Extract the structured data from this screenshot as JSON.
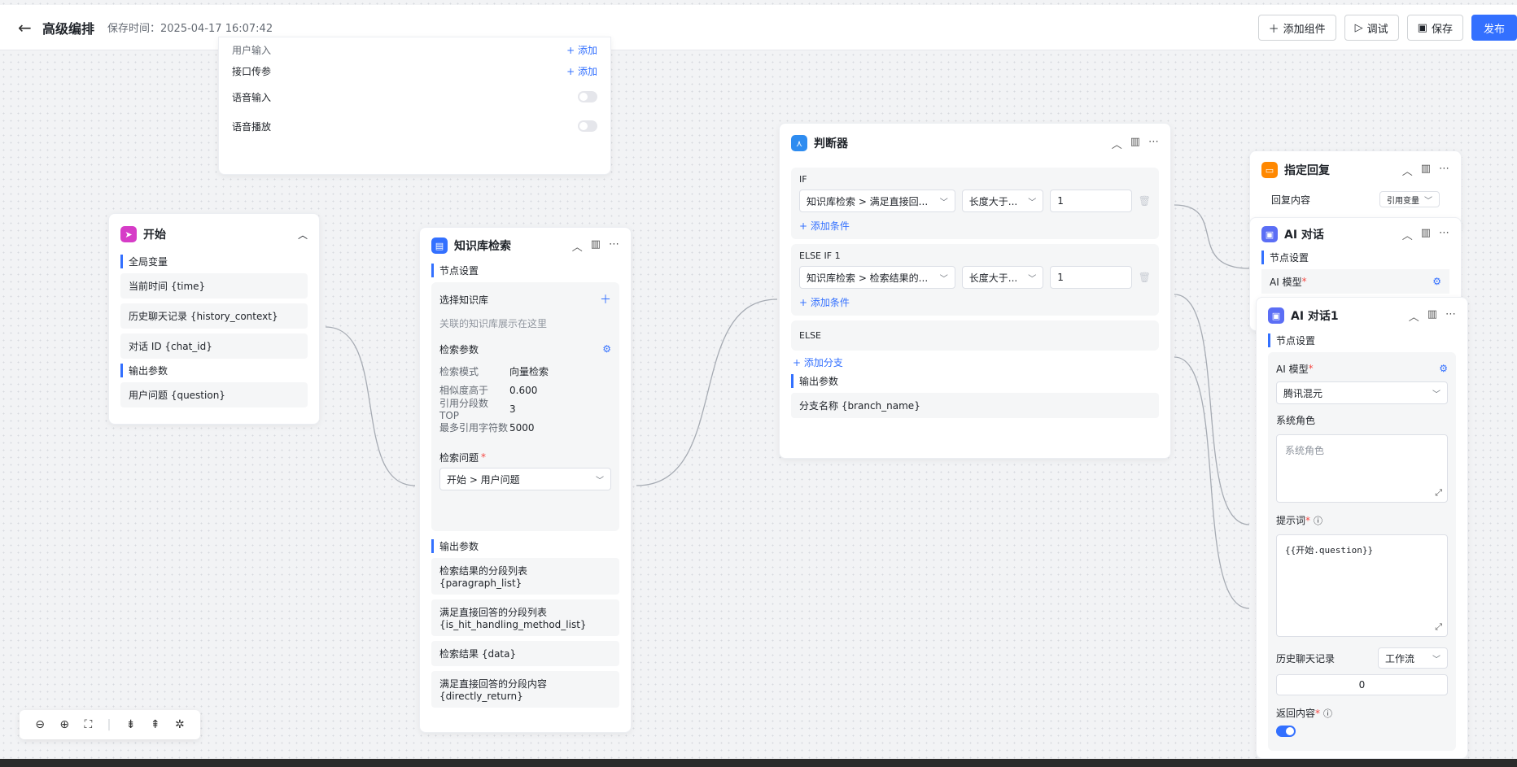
{
  "header": {
    "title": "高级编排",
    "save_time": "保存时间：2025-04-17 16:07:42"
  },
  "toolbar": {
    "add_component": "添加组件",
    "debug": "调试",
    "save": "保存",
    "publish": "发布"
  },
  "settings_card": {
    "partial_label": "用户输入",
    "partial_add": "+ 添加",
    "api_params": "接口传参",
    "api_add": "+ 添加",
    "voice_input": "语音输入",
    "voice_play": "语音播放"
  },
  "start_node": {
    "title": "开始",
    "global_vars_label": "全局变量",
    "global_vars": [
      "当前时间 {time}",
      "历史聊天记录 {history_context}",
      "对话 ID {chat_id}"
    ],
    "output_label": "输出参数",
    "outputs": [
      "用户问题 {question}"
    ]
  },
  "kb_node": {
    "title": "知识库检索",
    "node_settings": "节点设置",
    "select_kb": "选择知识库",
    "kb_placeholder": "关联的知识库展示在这里",
    "search_params": "检索参数",
    "params": [
      {
        "k": "检索模式",
        "v": "向量检索"
      },
      {
        "k": "相似度高于",
        "v": "0.600"
      },
      {
        "k": "引用分段数 TOP",
        "v": "3"
      },
      {
        "k": "最多引用字符数",
        "v": "5000"
      }
    ],
    "question_label": "检索问题",
    "required_mark": "*",
    "question_value": "开始 > 用户问题",
    "output_label": "输出参数",
    "outputs": [
      "检索结果的分段列表 {paragraph_list}",
      "满足直接回答的分段列表 {is_hit_handling_method_list}",
      "检索结果 {data}",
      "满足直接回答的分段内容 {directly_return}"
    ]
  },
  "judge_node": {
    "title": "判断器",
    "if_label": "IF",
    "if_field": "知识库检索 > 满足直接回...",
    "if_op": "长度大于...",
    "if_value": "1",
    "add_condition": "+ 添加条件",
    "elseif_label": "ELSE IF 1",
    "elseif_field": "知识库检索 > 检索结果的...",
    "elseif_op": "长度大于...",
    "elseif_value": "1",
    "add_condition2": "+ 添加条件",
    "else_label": "ELSE",
    "add_branch": "+ 添加分支",
    "output_label": "输出参数",
    "output_value": "分支名称 {branch_name}"
  },
  "reply_node": {
    "title": "指定回复",
    "content_label": "回复内容",
    "ref_var": "引用变量"
  },
  "ai_node": {
    "title": "AI 对话",
    "node_settings": "节点设置",
    "model_label": "AI 模型",
    "required_mark": "*"
  },
  "ai1_node": {
    "title": "AI 对话1",
    "node_settings": "节点设置",
    "model_label": "AI 模型",
    "required_mark": "*",
    "model_value": "腾讯混元",
    "system_role_label": "系统角色",
    "system_role_placeholder": "系统角色",
    "prompt_label": "提示词",
    "prompt_value": "{{开始.question}}",
    "history_label": "历史聊天记录",
    "history_select": "工作流",
    "history_count": "0",
    "return_label": "返回内容"
  },
  "colors": {
    "accent": "#3370ff",
    "start": "#d63cc7",
    "kb": "#3370ff",
    "judge": "#2e8cf0",
    "reply": "#ff8800",
    "ai": "#5b6ef5"
  }
}
